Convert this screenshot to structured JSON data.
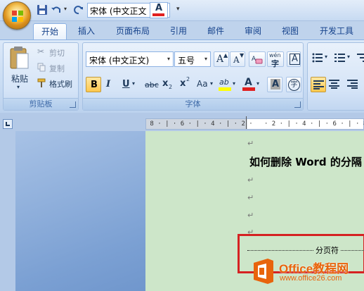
{
  "qat": {
    "font_value": "宋体 (中文正文",
    "font_color_letter": "A"
  },
  "tabs": [
    {
      "label": "开始",
      "active": true
    },
    {
      "label": "插入"
    },
    {
      "label": "页面布局"
    },
    {
      "label": "引用"
    },
    {
      "label": "邮件"
    },
    {
      "label": "审阅"
    },
    {
      "label": "视图"
    },
    {
      "label": "开发工具"
    }
  ],
  "clipboard": {
    "paste": "粘贴",
    "cut": "剪切",
    "copy": "复制",
    "format_painter": "格式刷",
    "group_label": "剪贴板"
  },
  "font": {
    "font_name": "宋体 (中文正文)",
    "font_size": "五号",
    "grow": "A",
    "shrink": "A",
    "bold": "B",
    "italic": "I",
    "underline": "U",
    "strike": "abc",
    "subscript": "x",
    "superscript": "x",
    "change_case": "Aa",
    "highlight": "ab",
    "font_color": "A",
    "shading": "A",
    "enclose": "字",
    "phonetic": "wén",
    "border": "A",
    "group_label": "字体"
  },
  "document": {
    "title": "如何删除 Word 的分隔",
    "para_mark": "↵",
    "page_break_label": "分页符"
  },
  "ruler": {
    "marks": " 8 · | · 6 · | · 4 · | · 2 ·   · 2 · | · 4 · | · 6 · | · 8 ·"
  },
  "watermark": {
    "text": "Office教程网",
    "url": "www.office26.com"
  },
  "colors": {
    "accent": "#15428b",
    "page": "#cde6c9",
    "highlight_box": "#d52222",
    "watermark": "#e8640c"
  }
}
